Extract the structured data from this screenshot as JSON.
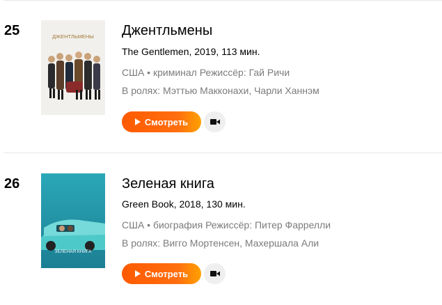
{
  "films": [
    {
      "rank": "25",
      "title": "Джентльмены",
      "original": "The Gentlemen, 2019, 113 мин.",
      "meta": "США • криминал  Режиссёр: Гай Ричи",
      "cast": "В ролях: Мэттью Макконахи, Чарли Ханнэм",
      "poster_text": "ДЖЕНТЛЬМЕНЫ",
      "watch_label": "Смотреть",
      "trailer_icon": "video-camera-icon"
    },
    {
      "rank": "26",
      "title": "Зеленая книга",
      "original": "Green Book, 2018, 130 мин.",
      "meta": "США • биография  Режиссёр: Питер Фаррелли",
      "cast": "В ролях: Вигго Мортенсен, Махершала Али",
      "poster_text": "ЗЕЛЕНАЯ КНИГА",
      "watch_label": "Смотреть",
      "trailer_icon": "video-camera-icon"
    }
  ],
  "colors": {
    "accent": "#ff5a00",
    "meta_text": "#7b7b7b",
    "divider": "#e6e6e6"
  }
}
